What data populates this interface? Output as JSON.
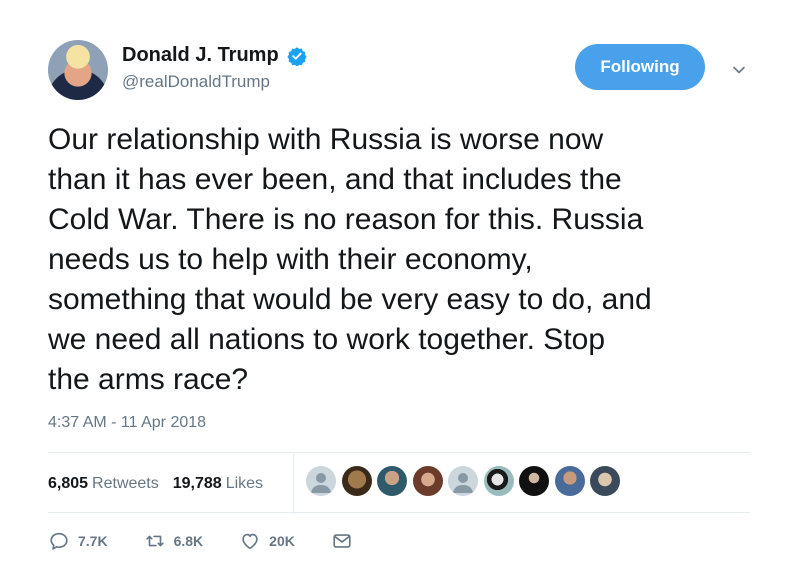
{
  "user": {
    "display_name": "Donald J. Trump",
    "handle": "@realDonaldTrump",
    "verified": true
  },
  "follow_button_label": "Following",
  "tweet": {
    "text": "Our relationship with Russia is worse now\nthan it has ever been, and that includes the\nCold War. There is no reason for this. Russia\nneeds us to help with their economy,\nsomething that would be very easy to do, and\nwe need all nations to work together. Stop\nthe arms race?",
    "timestamp": "4:37 AM - 11 Apr 2018"
  },
  "stats": {
    "retweets_count": "6,805",
    "retweets_label": "Retweets",
    "likes_count": "19,788",
    "likes_label": "Likes"
  },
  "actions": {
    "reply_count": "7.7K",
    "retweet_count": "6.8K",
    "like_count": "20K"
  },
  "colors": {
    "accent": "#4aa1eb",
    "muted_text": "#657786",
    "divider": "#e6ecf0"
  }
}
